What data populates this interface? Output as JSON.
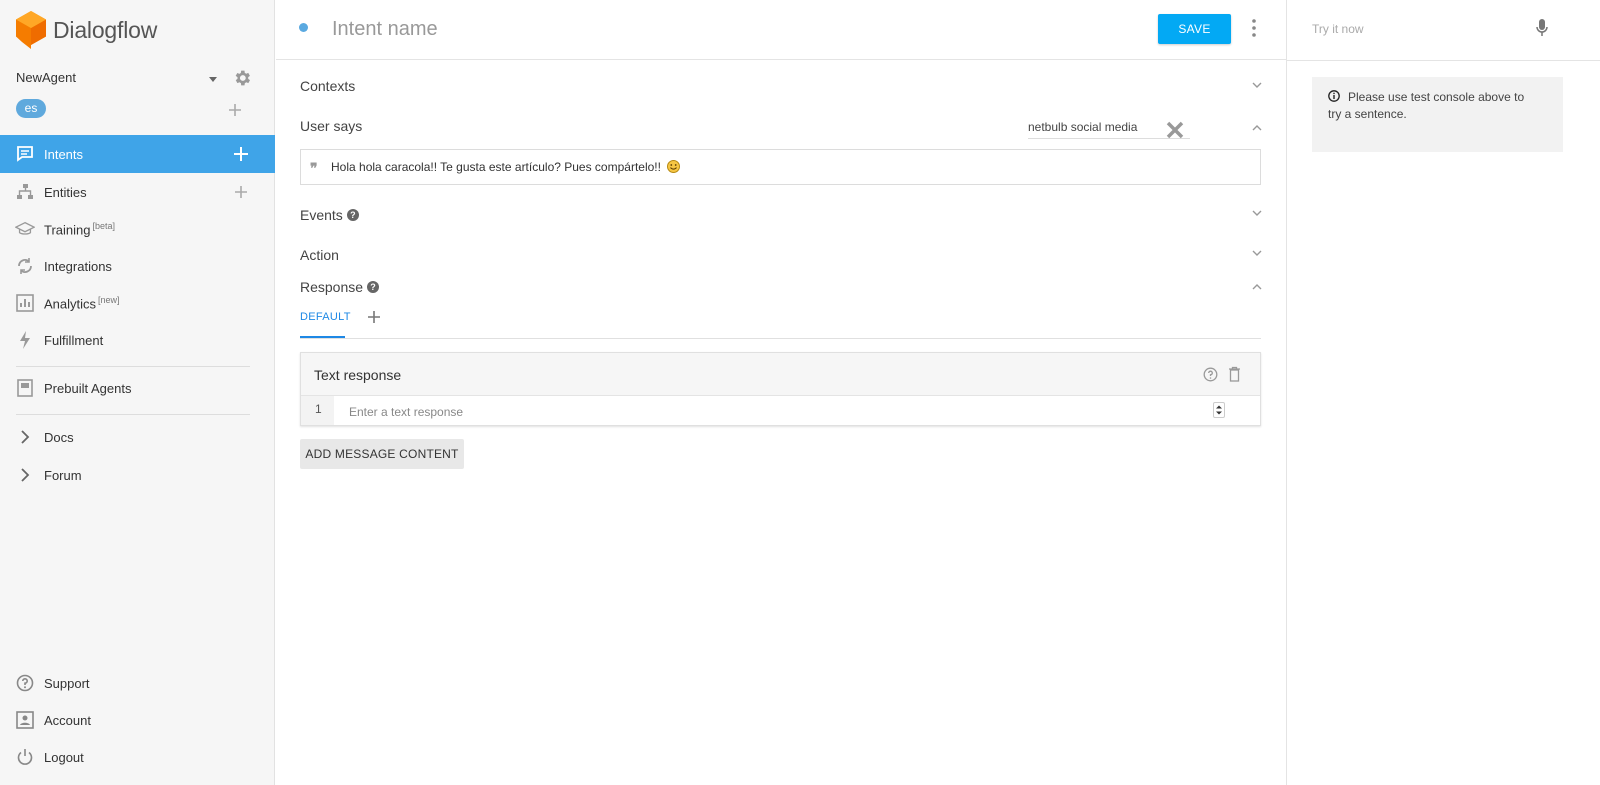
{
  "app": {
    "name": "Dialogflow"
  },
  "agent": {
    "name": "NewAgent",
    "language": "es"
  },
  "sidebar": {
    "items": [
      {
        "label": "Intents",
        "badge": "",
        "icon": "chat-icon",
        "active": true,
        "has_add": true
      },
      {
        "label": "Entities",
        "badge": "",
        "icon": "hierarchy-icon",
        "active": false,
        "has_add": true
      },
      {
        "label": "Training",
        "badge": "[beta]",
        "icon": "graduation-cap-icon",
        "active": false,
        "has_add": false
      },
      {
        "label": "Integrations",
        "badge": "",
        "icon": "sync-icon",
        "active": false,
        "has_add": false
      },
      {
        "label": "Analytics",
        "badge": "[new]",
        "icon": "bar-chart-icon",
        "active": false,
        "has_add": false
      },
      {
        "label": "Fulfillment",
        "badge": "",
        "icon": "lightning-icon",
        "active": false,
        "has_add": false
      },
      {
        "label": "Prebuilt Agents",
        "badge": "",
        "icon": "book-icon",
        "active": false,
        "has_add": false
      },
      {
        "label": "Docs",
        "badge": "",
        "icon": "chevron-right-icon",
        "active": false,
        "has_add": false
      },
      {
        "label": "Forum",
        "badge": "",
        "icon": "chevron-right-icon",
        "active": false,
        "has_add": false
      }
    ],
    "bottom": [
      {
        "label": "Support",
        "icon": "help-circle-icon"
      },
      {
        "label": "Account",
        "icon": "account-box-icon"
      },
      {
        "label": "Logout",
        "icon": "power-icon"
      }
    ]
  },
  "header": {
    "intent_name_placeholder": "Intent name",
    "save_label": "SAVE"
  },
  "sections": {
    "contexts": "Contexts",
    "user_says": "User says",
    "events": "Events",
    "action": "Action",
    "response": "Response"
  },
  "user_says": {
    "search_value": "netbulb social media",
    "phrases": [
      "Hola hola caracola!! Te gusta este artículo? Pues compártelo!!"
    ]
  },
  "response": {
    "tabs": [
      "DEFAULT"
    ],
    "card_title": "Text response",
    "row_number": "1",
    "text_placeholder": "Enter a text response",
    "add_content_label": "ADD MESSAGE CONTENT"
  },
  "test_console": {
    "placeholder": "Try it now",
    "info_message": "Please use test console above to try a sentence."
  },
  "colors": {
    "accent": "#3fa4e8",
    "save_button": "#03a9f4",
    "logo_orange": "#f57c00"
  }
}
